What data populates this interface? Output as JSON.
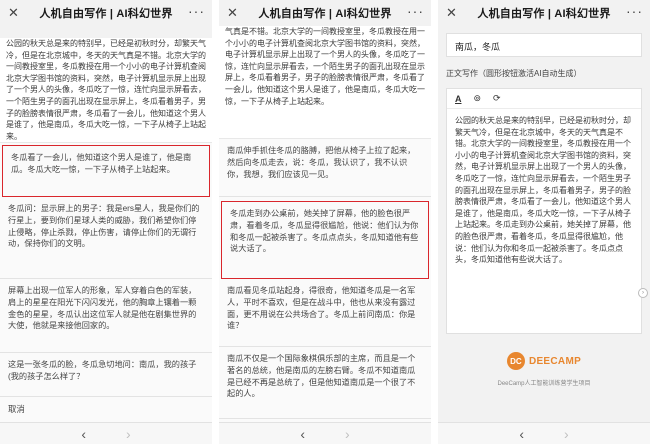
{
  "app": {
    "title": "人机自由写作 | AI科幻世界",
    "close": "✕",
    "more": "···"
  },
  "nav": {
    "back": "‹",
    "forward": "›"
  },
  "colors": {
    "selection": "#d9262c",
    "brand": "#e8872f"
  },
  "panel1": {
    "doc": "公园的秋天总是来的特别早，已经是初秋时分，却繁天气冷，但是在北京城中，冬天的天气真是不错。北京大学的一间教授室里，冬瓜教授在用一个小小的电子计算机查阅北京大学图书馆的资料，突然，电子计算机显示屏上出现了一个男人的头像，冬瓜吃了一惊，连忙向显示屏看去，一个陌生男子的面孔出现在显示屏上，冬瓜看着男子，男子的脸膀表情很严肃，冬瓜看了一会儿，他知道这个男人是谁了，他是南瓜，冬瓜大吃一惊，一下子从椅子上站起来。",
    "options": [
      "冬瓜看了一会儿，他知道这个男人是谁了，他是南瓜。冬瓜大吃一惊，一下子从椅子上站起来。",
      "冬瓜问：显示屏上的男子：我是ers星人，我是你们的行星上，要到你们星球人类的威胁，我们希望你们停止侵略，停止杀戮，停止伤害，请停止你们的无谓行动，保持你们的文明。",
      "屏幕上出现一位军人的形象，军人穿着白色的军装，肩上的星星在阳光下闪闪发光，他的胸章上镶着一颗金色的星星，冬瓜认出这位军人就是他在剧集世界的大使，他就是来接他回家的。",
      "这是一张冬瓜的脸，冬瓜急切地问：南瓜，我的孩子(我的孩子怎么样了？"
    ],
    "cancel": "取消"
  },
  "panel2": {
    "doc": "气真是不错。北京大学的一间教授室里，冬瓜教授在用一个小小的电子计算机查阅北京大学图书馆的资料，突然，电子计算机显示屏上出现了一个男人的头像，冬瓜吃了一惊，连忙向显示屏看去，一个陌生男子的面孔出现在显示屏上，冬瓜看着男子，男子的脸膀表情很严肃，冬瓜看了一会儿，他知道这个男人是谁了，他是南瓜，冬瓜大吃一惊，一下子从椅子上站起来。",
    "options": [
      "南瓜伸手抓住冬瓜的胳膊，把他从椅子上拉了起来，然后向冬瓜走去，说：冬瓜，我认识了，我不认识你，我想，我们应该见一见。",
      "冬瓜走到办公桌前，她关掉了屏幕，他的脸色很严肃，看着冬瓜，冬瓜显得很尴尬，他说：他们认为你和冬瓜一起被杀害了。冬瓜点点头，冬瓜知道他有些说大话了。",
      "南瓜看见冬瓜站起身，得很奇，他知道冬瓜是一名军人，平时不喜欢，但是在战斗中，他也从来没有露过面，更不用说在公共场合了。冬瓜上前问南瓜：你是谁？",
      "南瓜不仅是一个国际象棋俱乐部的主席，而且是一个著名的总统，他是南瓜的左膀右臂。冬瓜不知道南瓜是已经不再是总统了，但是他知道南瓜是一个很了不起的人。"
    ]
  },
  "panel3": {
    "keyword": "南瓜，冬瓜",
    "section_label": "正文写作（圆形按钮激活AI自动生成）",
    "toolbar": {
      "bold": "A",
      "record": "⊚",
      "refresh": "⟳"
    },
    "text": "公园的秋天总是来的特别早，已经是初秋时分，却繁天气冷，但是在北京城中，冬天的天气真是不错。北京大学的一间教授室里，冬瓜教授在用一个小小的电子计算机查阅北京大学图书馆的资料，突然，电子计算机显示屏上出现了一个男人的头像，冬瓜吃了一惊，连忙向显示屏看去，一个陌生男子的面孔出现在显示屏上，冬瓜看着男子，男子的脸膀表情很严肃，冬瓜看了一会儿，他知道这个男人是谁了，他是南瓜，冬瓜大吃一惊，一下子从椅子上站起来。冬瓜走到办公桌前，她关掉了屏幕，他的脸色很严肃，看着冬瓜，冬瓜显得很尴尬，他说：他们认为你和冬瓜一起被杀害了。冬瓜点点头，冬瓜知道他有些说大话了。",
    "scroll_handle": "›",
    "logo_mark": "DC",
    "logo_text": "DEECAMP",
    "logo_caption": "DeeCamp人工智能训练营学生项目"
  }
}
